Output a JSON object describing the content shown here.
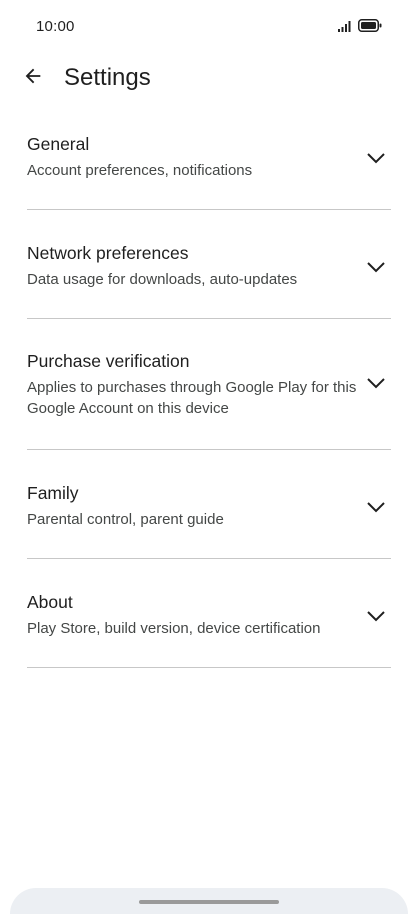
{
  "status_bar": {
    "time": "10:00",
    "icons": [
      "signal-icon",
      "battery-icon"
    ]
  },
  "app_bar": {
    "back_icon": "arrow-left-icon",
    "title": "Settings"
  },
  "settings": {
    "items": [
      {
        "title": "General",
        "subtitle": "Account preferences, notifications",
        "icon": "chevron-down-icon"
      },
      {
        "title": "Network preferences",
        "subtitle": "Data usage for downloads, auto-updates",
        "icon": "chevron-down-icon"
      },
      {
        "title": "Purchase verification",
        "subtitle": "Applies to purchases through Google Play for this Google Account on this device",
        "icon": "chevron-down-icon"
      },
      {
        "title": "Family",
        "subtitle": "Parental control, parent guide",
        "icon": "chevron-down-icon"
      },
      {
        "title": "About",
        "subtitle": "Play Store, build version, device certification",
        "icon": "chevron-down-icon"
      }
    ]
  },
  "colors": {
    "text_primary": "#1f1f1f",
    "text_secondary": "#444746",
    "divider": "#c7c7c7",
    "nav_background": "#eceff3"
  }
}
